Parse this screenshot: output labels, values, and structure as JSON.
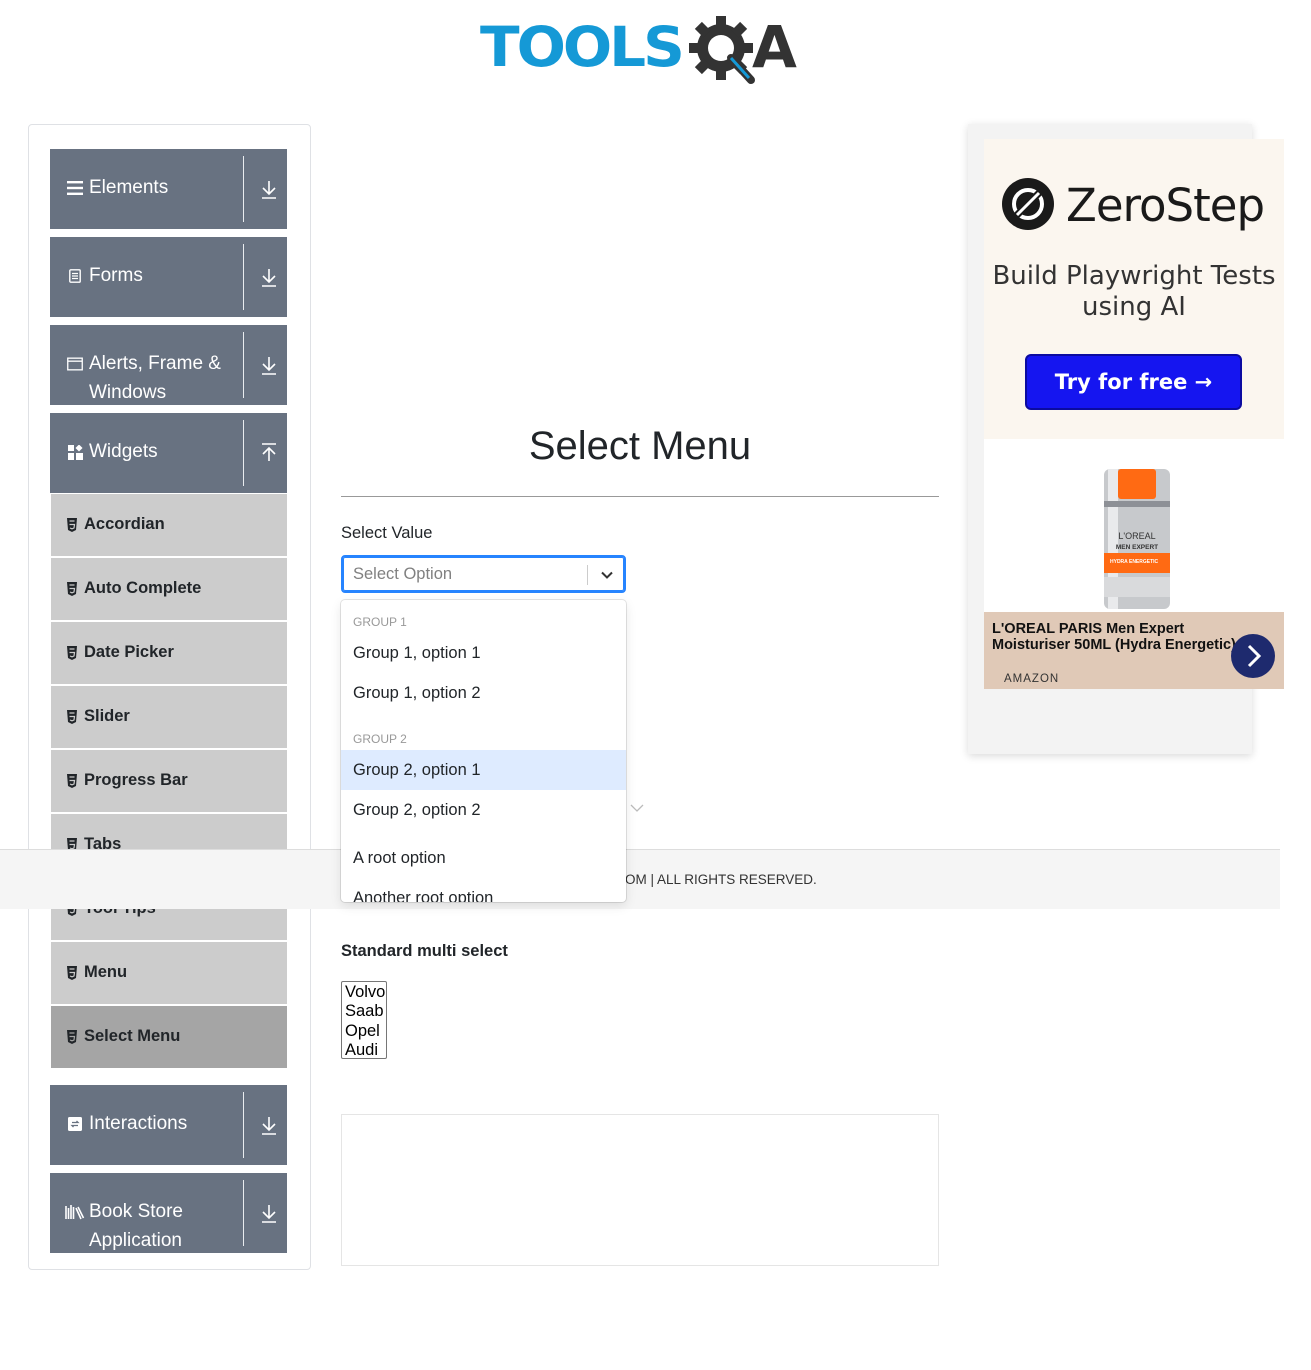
{
  "header": {
    "logo_text": "TOOLS",
    "logo_suffix": "A"
  },
  "sidebar": {
    "groups": [
      {
        "label": "Elements",
        "icon": "hamburger-icon",
        "arrow": "download-arrow-icon"
      },
      {
        "label": "Forms",
        "icon": "form-doc-icon",
        "arrow": "download-arrow-icon"
      },
      {
        "label": "Alerts, Frame & Windows",
        "icon": "window-icon",
        "arrow": "download-arrow-icon"
      },
      {
        "label": "Widgets",
        "icon": "widgets-icon",
        "arrow": "upload-arrow-icon"
      },
      {
        "label": "Interactions",
        "icon": "interactions-icon",
        "arrow": "download-arrow-icon"
      },
      {
        "label": "Book Store Application",
        "icon": "books-icon",
        "arrow": "download-arrow-icon"
      }
    ],
    "items": [
      {
        "label": "Accordian"
      },
      {
        "label": "Auto Complete"
      },
      {
        "label": "Date Picker"
      },
      {
        "label": "Slider"
      },
      {
        "label": "Progress Bar"
      },
      {
        "label": "Tabs"
      },
      {
        "label": "Tool Tips"
      },
      {
        "label": "Menu"
      },
      {
        "label": "Select Menu",
        "active": true
      }
    ]
  },
  "main": {
    "title": "Select Menu",
    "select_value": {
      "label": "Select Value",
      "placeholder": "Select Option",
      "menu": {
        "group1_head": "Group 1",
        "group1_opt1": "Group 1, option 1",
        "group1_opt2": "Group 1, option 2",
        "group2_head": "Group 2",
        "group2_opt1": "Group 2, option 1",
        "group2_opt2": "Group 2, option 2",
        "root1": "A root option",
        "root2": "Another root option"
      }
    },
    "multi_select": {
      "label": "Standard multi select",
      "options": [
        "Volvo",
        "Saab",
        "Opel",
        "Audi"
      ]
    }
  },
  "footer": {
    "text": "OM | ALL RIGHTS RESERVED."
  },
  "ads": {
    "zerostep": {
      "brand": "ZeroStep",
      "tagline": "Build Playwright Tests using AI",
      "button": "Try for free →"
    },
    "loreal": {
      "title": "L'OREAL PARIS Men Expert Moisturiser 50ML (Hydra Energetic)",
      "source": "AMAZON",
      "jar_brand": "L'OREAL",
      "jar_line": "MEN EXPERT",
      "jar_sub": "HYDRA ENERGETIC"
    }
  },
  "colors": {
    "brand_blue": "#1599d6",
    "sidebar_group": "#687281",
    "sidebar_item": "#cccccc",
    "sidebar_item_active": "#a5a5a5",
    "focus_blue": "#2684ff",
    "option_focus": "#deebff",
    "ad_button": "#1515f0"
  }
}
